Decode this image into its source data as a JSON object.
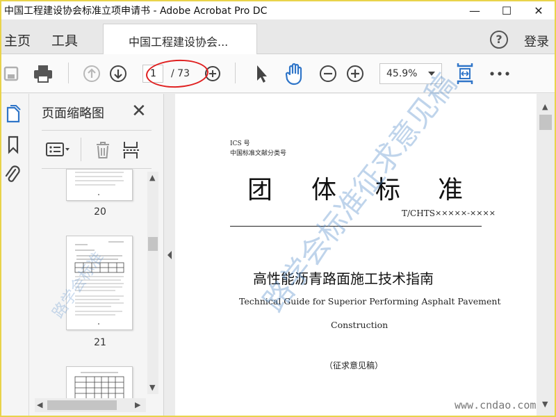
{
  "window": {
    "title": "中国工程建设协会标准立项申请书 - Adobe Acrobat Pro DC",
    "minimize": "—",
    "maximize": "☐",
    "close": "✕"
  },
  "tabs": {
    "home": "主页",
    "tools": "工具",
    "document": "中国工程建设协会...",
    "help": "?",
    "login": "登录"
  },
  "toolbar": {
    "page_current": "1",
    "page_total": "/ 73",
    "zoom": "45.9%"
  },
  "panel": {
    "title": "页面缩略图",
    "close": "✕",
    "thumbnails": [
      {
        "label": "20"
      },
      {
        "label": "21"
      }
    ]
  },
  "document": {
    "ics": "ICS 号",
    "cat": "中国标准文献分类号",
    "std": [
      "团",
      "体",
      "标",
      "准"
    ],
    "code_prefix": "T/CHTS",
    "code_value": "×××××-××××",
    "title_cn": "高性能沥青路面施工技术指南",
    "title_en_1": "Technical Guide for Superior Performing Asphalt Pavement",
    "title_en_2": "Construction",
    "status": "（征求意见稿）",
    "watermark": "路学会标准征求意见稿"
  },
  "site": "www.cndao.com",
  "colors": {
    "accent": "#2f75c8",
    "annotation": "#e02020"
  }
}
